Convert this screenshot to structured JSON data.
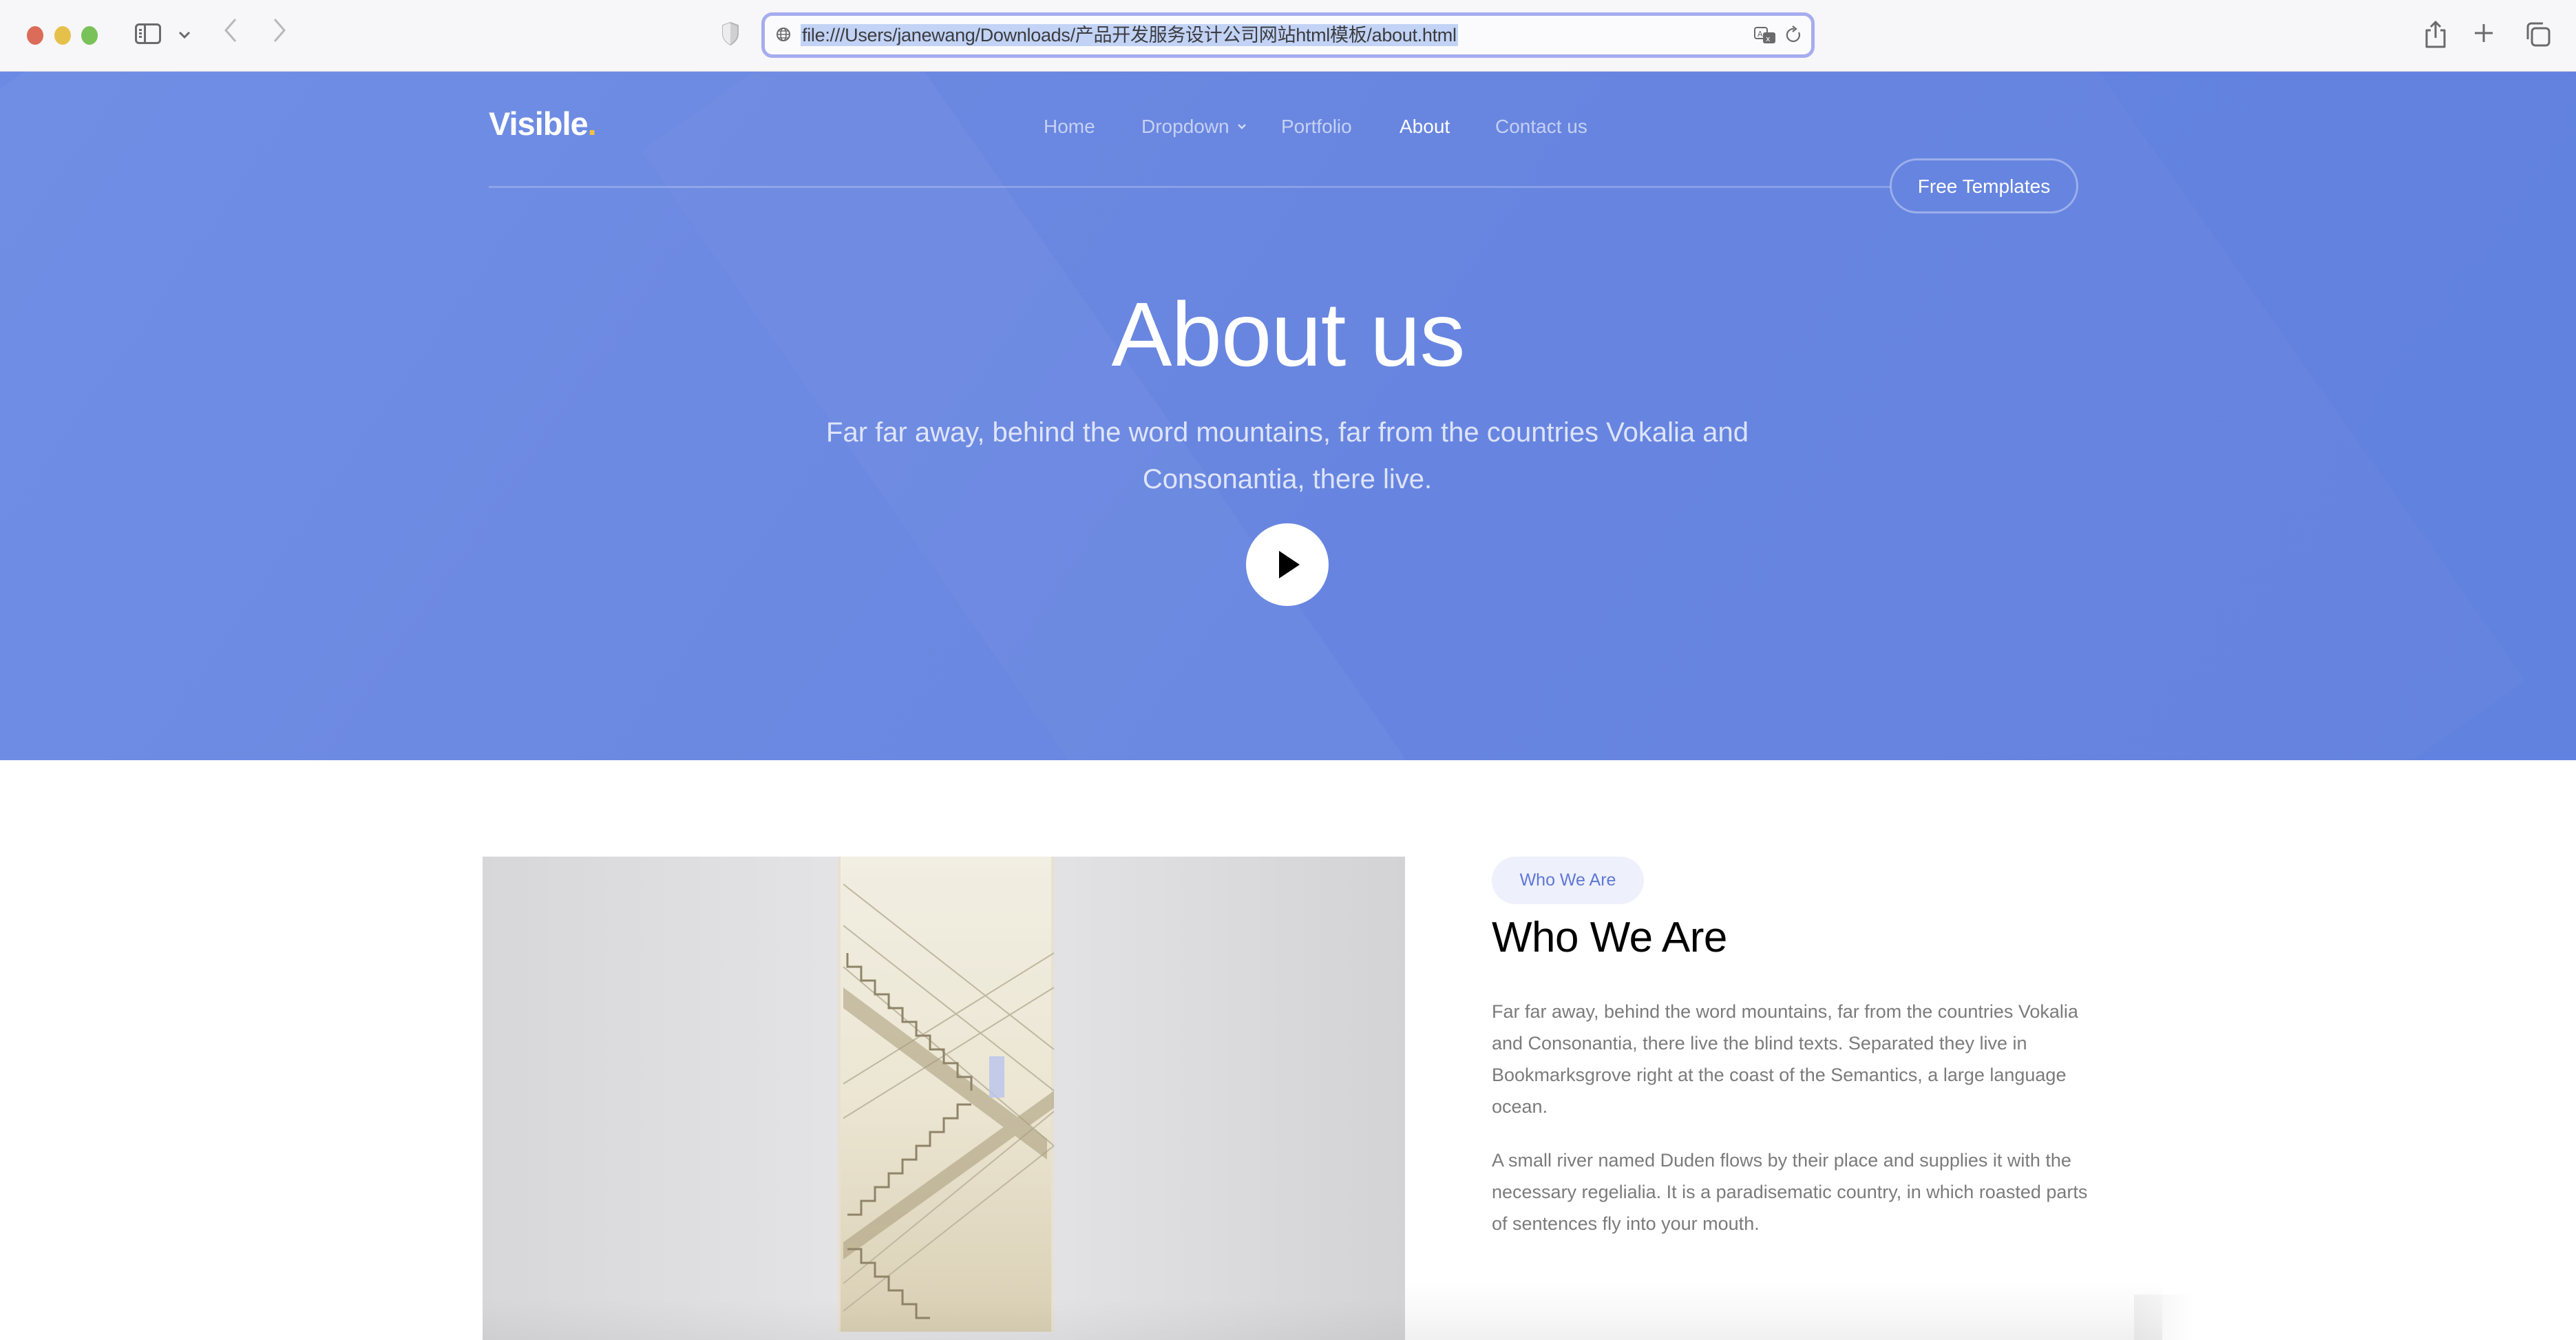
{
  "browser": {
    "url": "file:///Users/janewang/Downloads/产品开发服务设计公司网站html模板/about.html",
    "icons": {
      "traffic_lights": [
        "close",
        "minimize",
        "zoom"
      ],
      "sidebar": "sidebar-icon",
      "back": "chevron-left-icon",
      "forward": "chevron-right-icon",
      "privacy": "shield-icon",
      "site": "globe-icon",
      "translate": "translate-icon",
      "reload": "reload-icon",
      "share": "share-icon",
      "new_tab": "plus-icon",
      "tab_overview": "tabs-icon"
    }
  },
  "site": {
    "logo_text": "Visible",
    "logo_dot": ".",
    "accent_color": "#f5c242",
    "hero_color": "#6483e0",
    "nav": [
      {
        "label": "Home",
        "active": false
      },
      {
        "label": "Dropdown",
        "active": false,
        "has_caret": true
      },
      {
        "label": "Portfolio",
        "active": false
      },
      {
        "label": "About",
        "active": true
      },
      {
        "label": "Contact us",
        "active": false
      }
    ],
    "nav_caret": "⌄",
    "cta_label": "Free Templates"
  },
  "hero": {
    "title": "About us",
    "subtitle_line1": "Far far away, behind the word mountains, far from the countries Vokalia and",
    "subtitle_line2": "Consonantia, there live.",
    "play_icon": "play-icon"
  },
  "about": {
    "badge": "Who We Are",
    "heading": "Who We Are",
    "paragraphs": [
      "Far far away, behind the word mountains, far from the countries Vokalia and Consonantia, there live the blind texts. Separated they live in Bookmarksgrove right at the coast of the Semantics, a large language ocean.",
      "A small river named Duden flows by their place and supplies it with the necessary regelialia. It is a paradisematic country, in which roasted parts of sentences fly into your mouth."
    ],
    "image_alt": "staircase-photo"
  }
}
